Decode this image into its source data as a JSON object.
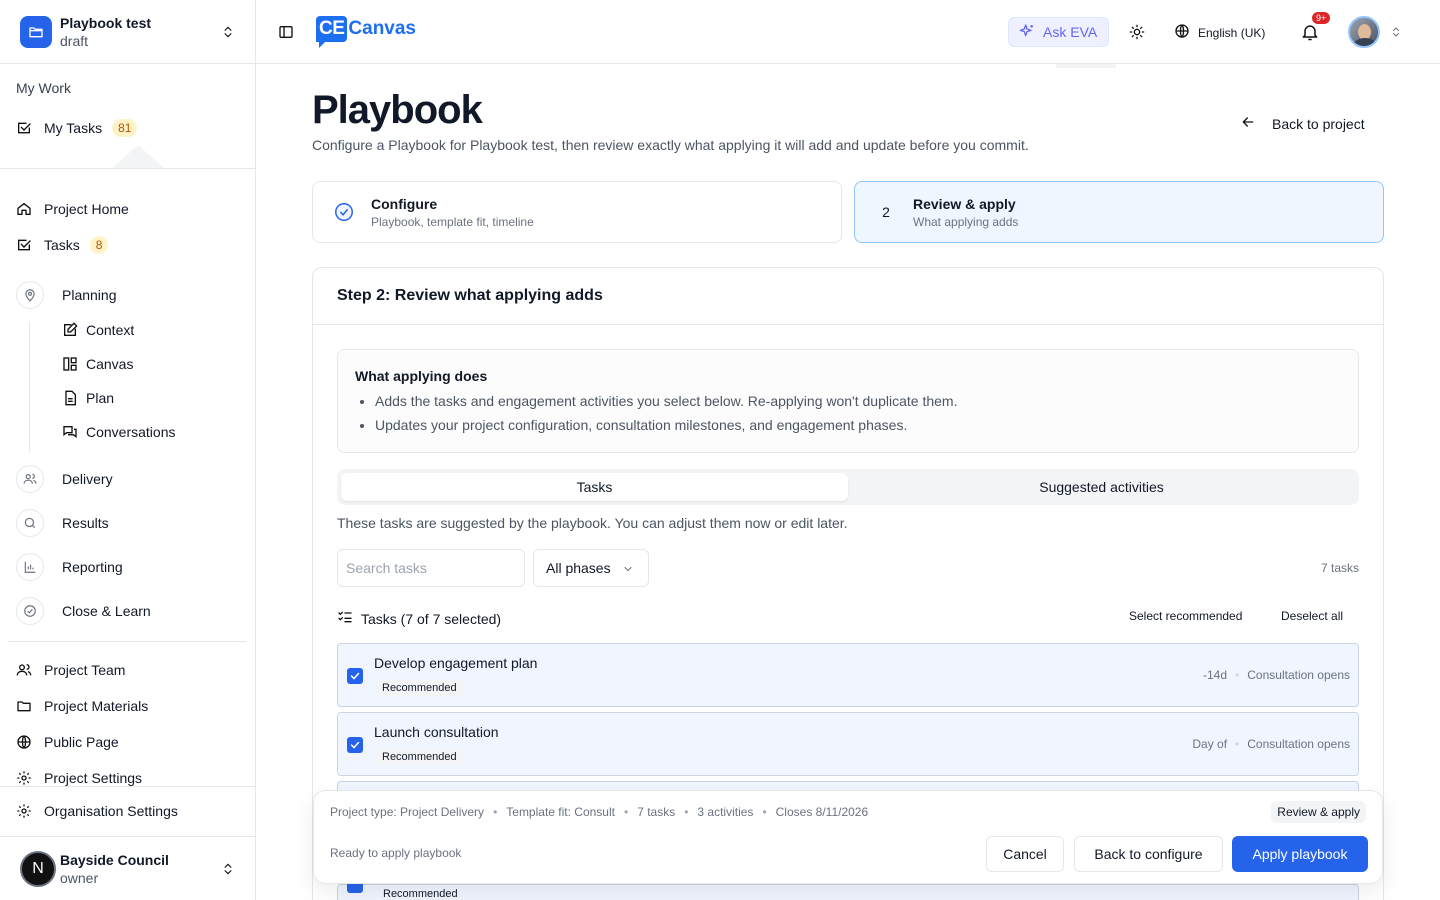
{
  "project": {
    "name": "Playbook test",
    "status": "draft"
  },
  "sidebar": {
    "my_work_label": "My Work",
    "my_tasks": {
      "label": "My Tasks",
      "badge": "81"
    },
    "project_home": "Project Home",
    "tasks": {
      "label": "Tasks",
      "badge": "8"
    },
    "planning": "Planning",
    "planning_sub": [
      "Context",
      "Canvas",
      "Plan",
      "Conversations"
    ],
    "delivery": "Delivery",
    "results": "Results",
    "reporting": "Reporting",
    "close_learn": "Close & Learn",
    "project_team": "Project Team",
    "project_materials": "Project Materials",
    "public_page": "Public Page",
    "project_settings": "Project Settings",
    "org_settings": "Organisation Settings",
    "org": {
      "initial": "N",
      "name": "Bayside Council",
      "role": "owner"
    }
  },
  "header": {
    "logo_mark": "CE",
    "logo_text": "Canvas",
    "ask_eva": "Ask EVA",
    "language": "English (UK)",
    "notif_count": "9+"
  },
  "page": {
    "title": "Playbook",
    "subtitle": "Configure a Playbook for Playbook test, then review exactly what applying it will add and update before you commit.",
    "back_link": "Back to project"
  },
  "steps": [
    {
      "title": "Configure",
      "desc": "Playbook, template fit, timeline"
    },
    {
      "num": "2",
      "title": "Review & apply",
      "desc": "What applying adds"
    }
  ],
  "review": {
    "heading": "Step 2: Review what applying adds",
    "info_title": "What applying does",
    "info_items": [
      "Adds the tasks and engagement activities you select below. Re-applying won't duplicate them.",
      "Updates your project configuration, consultation milestones, and engagement phases."
    ],
    "tabs": [
      "Tasks",
      "Suggested activities"
    ],
    "tab_note": "These tasks are suggested by the playbook. You can adjust them now or edit later.",
    "search_placeholder": "Search tasks",
    "phase_filter": "All phases",
    "count": "7 tasks",
    "list_title": "Tasks (7 of 7 selected)",
    "select_recommended": "Select recommended",
    "deselect_all": "Deselect all",
    "tasks": [
      {
        "title": "Develop engagement plan",
        "badge": "Recommended",
        "offset": "-14d",
        "anchor": "Consultation opens"
      },
      {
        "title": "Launch consultation",
        "badge": "Recommended",
        "offset": "Day of",
        "anchor": "Consultation opens"
      }
    ],
    "hidden_task_badge": "Recommended"
  },
  "footer": {
    "meta": [
      "Project type: Project Delivery",
      "Template fit: Consult",
      "7 tasks",
      "3 activities",
      "Closes 8/11/2026"
    ],
    "chip": "Review & apply",
    "ready": "Ready to apply playbook",
    "cancel": "Cancel",
    "back": "Back to configure",
    "apply": "Apply playbook"
  },
  "colors": {
    "accent": "#2563eb",
    "badge_bg": "#fef3c7",
    "badge_text": "#b45309",
    "eva": "#6366f1",
    "notif": "#dc2626"
  }
}
